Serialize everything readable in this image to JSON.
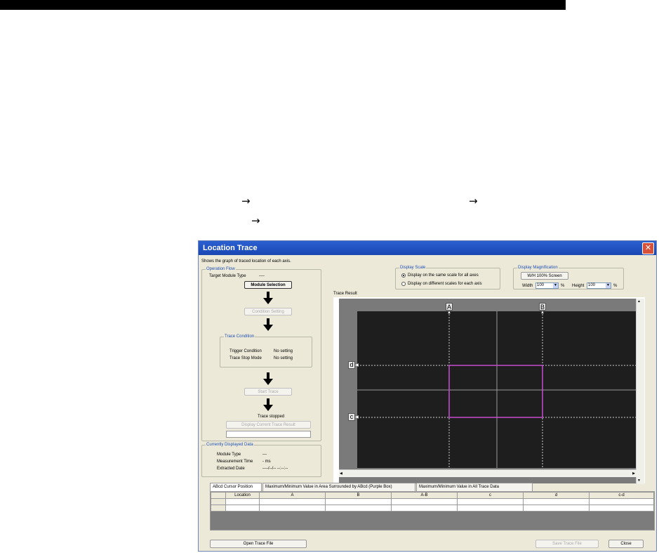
{
  "manual": {
    "arrow1": "→",
    "arrow2": "→",
    "arrow3": "→"
  },
  "window": {
    "title": "Location Trace",
    "close_glyph": "✕",
    "description": "Shows the graph of traced location of each axis."
  },
  "operation_flow": {
    "label": "Operation Flow",
    "target_module_label": "Target Module Type",
    "target_module_value": "----",
    "module_selection_button": "Module Selection",
    "condition_setting_button": "Condition Setting",
    "trace_condition": {
      "label": "Trace Condition",
      "trigger_condition_label": "Trigger Condition",
      "trigger_condition_value": "No setting",
      "trace_stop_mode_label": "Trace Stop Mode",
      "trace_stop_mode_value": "No setting"
    },
    "start_trace_button": "Start Trace",
    "status": "Trace stopped",
    "display_current_button": "Display Current Trace Result"
  },
  "displayed_data": {
    "label": "Currently Displayed Data",
    "module_type_label": "Module Type",
    "module_type_value": "---",
    "measurement_time_label": "Measurement Time",
    "measurement_time_value": "- ms",
    "extracted_date_label": "Extracted Date",
    "extracted_date_value": "----/--/-- --:--:--"
  },
  "display_scale": {
    "label": "Display Scale",
    "option_same": "Display on the same scale for all axes",
    "option_different": "Display on different scales for each axis",
    "selected": "same"
  },
  "display_magnification": {
    "label": "Display Magnification",
    "button": "W/H 100% Screen",
    "width_label": "Width",
    "width_value": "100",
    "height_label": "Height",
    "height_value": "100",
    "unit": "%"
  },
  "trace_result": {
    "label": "Trace Result",
    "cursor_a": "A",
    "cursor_b": "B",
    "cursor_c": "c",
    "cursor_d": "d",
    "box_color": "#c64bd0"
  },
  "tabs": [
    {
      "label": "ABcd Cursor Position"
    },
    {
      "label": "Maximum/Minimum Value in Area Surrounded by ABcd (Purple Box)"
    },
    {
      "label": "Maximum/Minimum Value in All Trace Data"
    }
  ],
  "table": {
    "columns": [
      "Location",
      "A",
      "B",
      "A-B",
      "c",
      "d",
      "c-d"
    ]
  },
  "footer": {
    "open_button": "Open Trace File",
    "save_button": "Save Trace File",
    "close_button": "Close"
  }
}
